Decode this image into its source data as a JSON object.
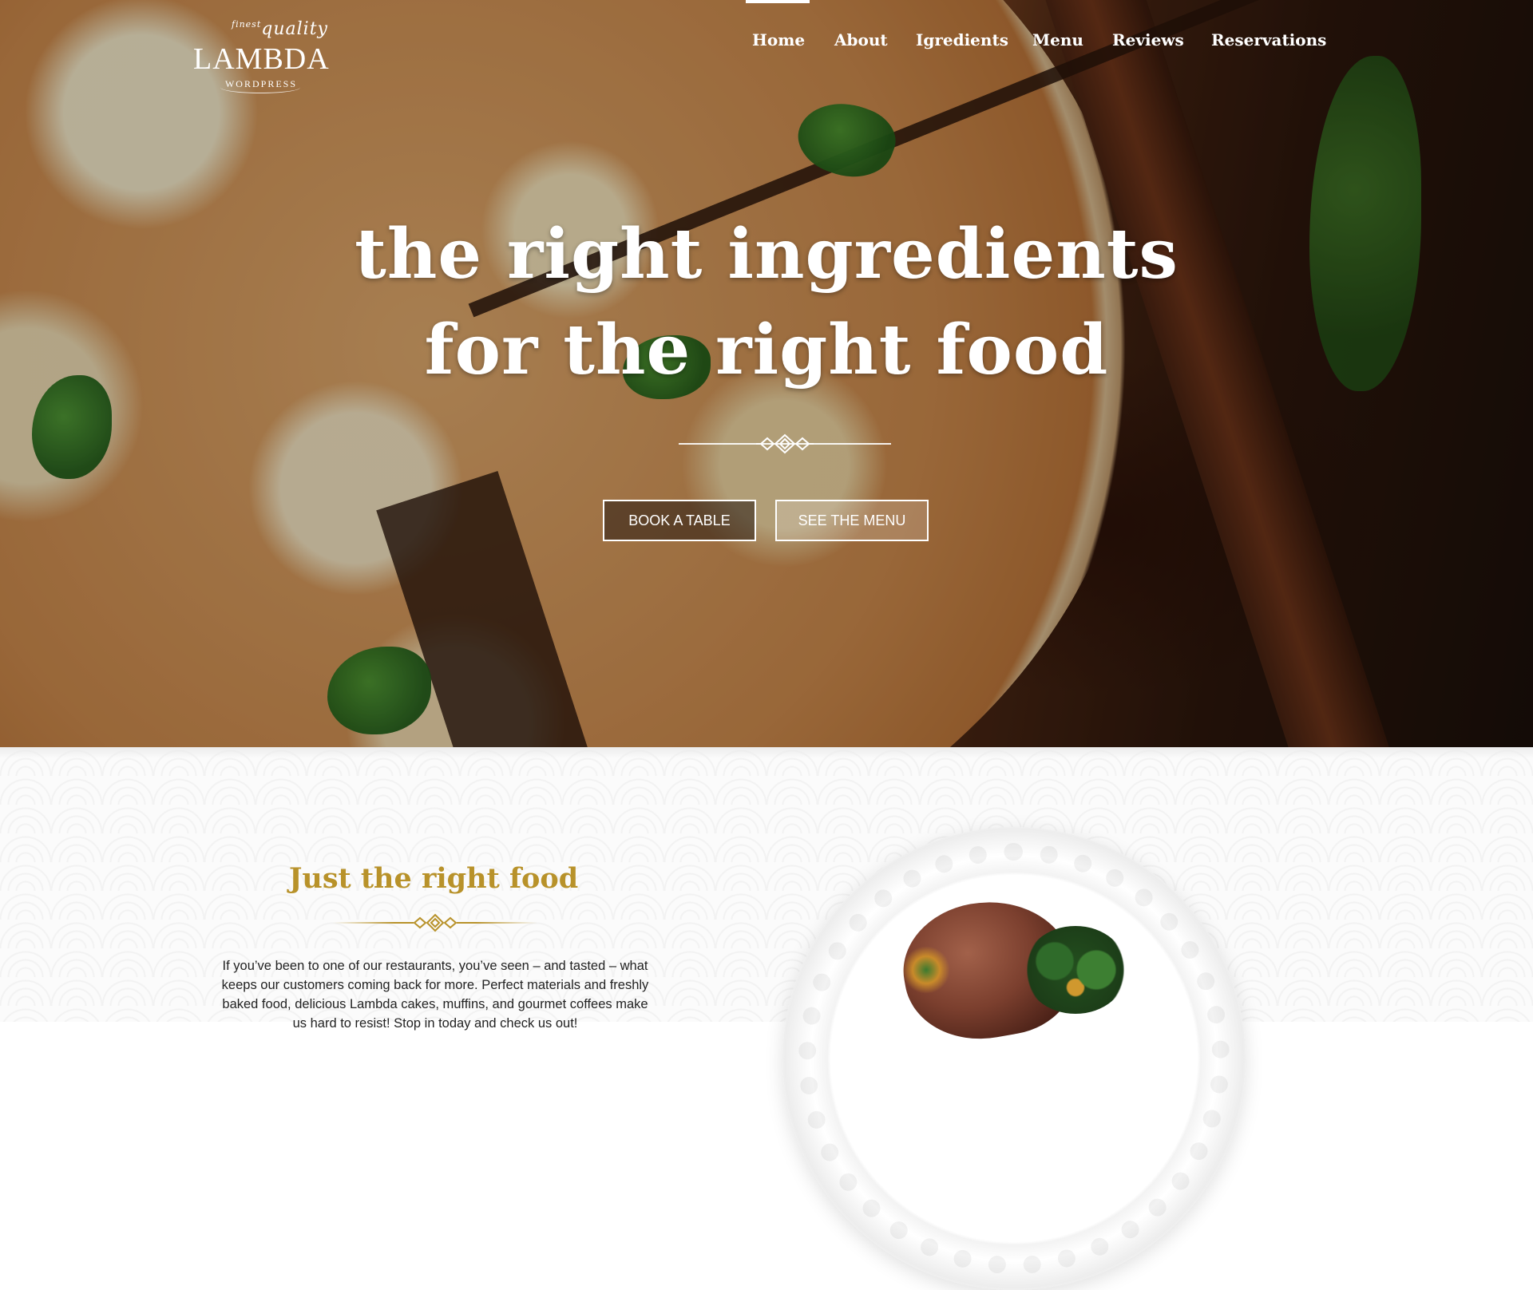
{
  "logo": {
    "finest": "finest",
    "quality": "quality",
    "brand": "LAMBDA",
    "sub": "WORDPRESS"
  },
  "nav": {
    "items": [
      {
        "label": "Home",
        "active": true
      },
      {
        "label": "About",
        "active": false
      },
      {
        "label": "Igredients",
        "active": false
      },
      {
        "label": "Menu",
        "active": false
      },
      {
        "label": "Reviews",
        "active": false
      },
      {
        "label": "Reservations",
        "active": false
      }
    ]
  },
  "hero": {
    "headline_line1": "the right ingredients",
    "headline_line2": "for the right food",
    "book_button": "BOOK A TABLE",
    "menu_button": "SEE THE MENU"
  },
  "about": {
    "title": "Just the right food",
    "text": "If you’ve been to one of our restaurants, you’ve seen – and tasted – what keeps our customers coming back for more. Perfect materials and freshly baked food, delicious Lambda cakes, muffins, and gourmet coffees make us hard to resist! Stop in today and check us out!"
  },
  "colors": {
    "accent_gold": "#b8922a",
    "nav_text": "#ffffff",
    "body_text": "#222222"
  },
  "icons": {
    "divider_ornament": "ornament-icon"
  }
}
